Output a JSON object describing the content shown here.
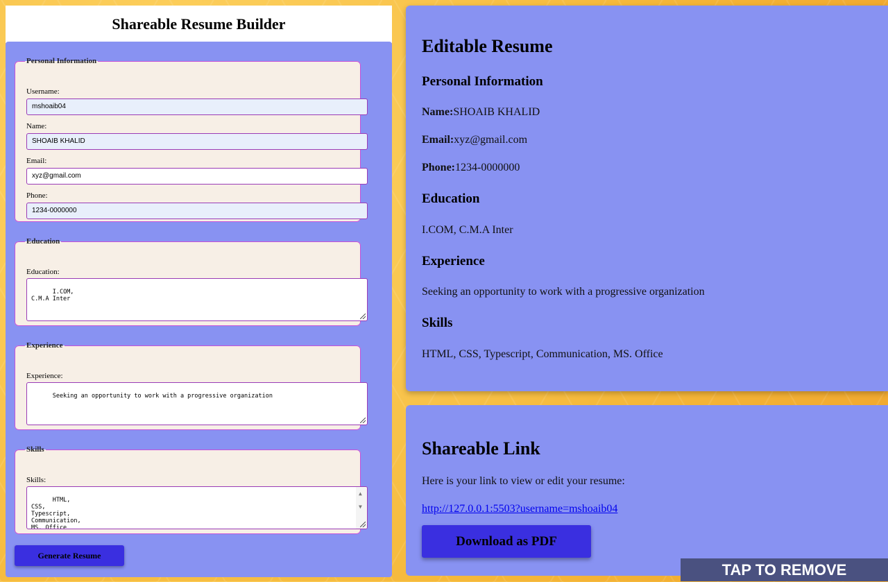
{
  "app": {
    "title": "Shareable Resume Builder"
  },
  "form": {
    "personal": {
      "legend": "Personal Information",
      "username_label": "Username:",
      "username_value": "mshoaib04",
      "name_label": "Name:",
      "name_value": "SHOAIB KHALID",
      "email_label": "Email:",
      "email_value": "xyz@gmail.com",
      "phone_label": "Phone:",
      "phone_value": "1234-0000000"
    },
    "education": {
      "legend": "Education",
      "label": "Education:",
      "value": "I.COM,\nC.M.A Inter"
    },
    "experience": {
      "legend": "Experience",
      "label": "Experience:",
      "value": "Seeking an opportunity to work with a progressive organization"
    },
    "skills": {
      "legend": "Skills",
      "label": "Skills:",
      "value": "HTML,\nCSS,\nTypescript,\nCommunication,\nMS. Office"
    },
    "generate_label": "Generate Resume"
  },
  "resume": {
    "heading": "Editable Resume",
    "personal_heading": "Personal Information",
    "name_key": "Name:",
    "name_val": "SHOAIB KHALID",
    "email_key": "Email:",
    "email_val": "xyz@gmail.com",
    "phone_key": "Phone:",
    "phone_val": "1234-0000000",
    "education_heading": "Education",
    "education_text": "I.COM, C.M.A Inter",
    "experience_heading": "Experience",
    "experience_text": "Seeking an opportunity to work with a progressive organization",
    "skills_heading": "Skills",
    "skills_text": "HTML, CSS, Typescript, Communication, MS. Office"
  },
  "share": {
    "heading": "Shareable Link",
    "text": "Here is your link to view or edit your resume:",
    "link": "http://127.0.0.1:5503?username=mshoaib04",
    "download_label": "Download as PDF"
  },
  "overlay": {
    "tap_remove": "TAP TO REMOVE"
  },
  "colors": {
    "panel": "#8892f2",
    "fieldset_bg": "#f7efe6",
    "fieldset_border": "#c451d8",
    "button": "#3a2fe0",
    "background": "#f7c64a"
  }
}
